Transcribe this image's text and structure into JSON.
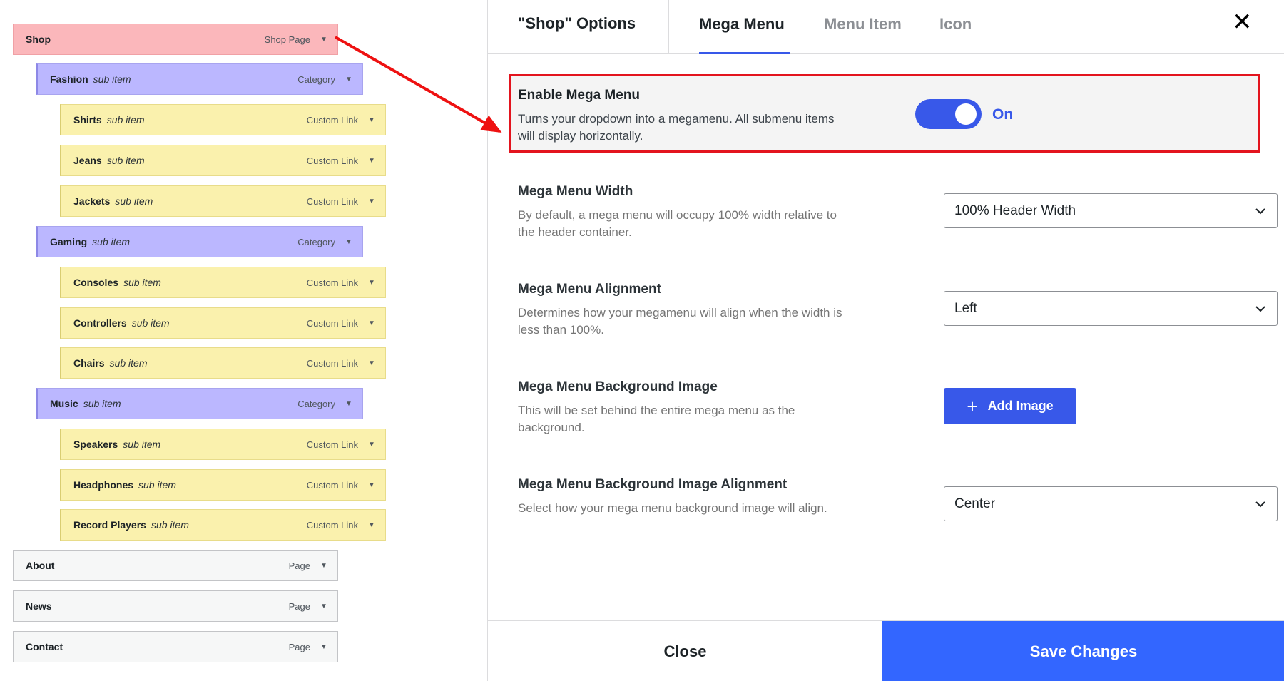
{
  "menu": {
    "items": [
      {
        "title": "Shop",
        "sub": "",
        "type": "Shop Page"
      },
      {
        "title": "Fashion",
        "sub": "sub item",
        "type": "Category"
      },
      {
        "title": "Shirts",
        "sub": "sub item",
        "type": "Custom Link"
      },
      {
        "title": "Jeans",
        "sub": "sub item",
        "type": "Custom Link"
      },
      {
        "title": "Jackets",
        "sub": "sub item",
        "type": "Custom Link"
      },
      {
        "title": "Gaming",
        "sub": "sub item",
        "type": "Category"
      },
      {
        "title": "Consoles",
        "sub": "sub item",
        "type": "Custom Link"
      },
      {
        "title": "Controllers",
        "sub": "sub item",
        "type": "Custom Link"
      },
      {
        "title": "Chairs",
        "sub": "sub item",
        "type": "Custom Link"
      },
      {
        "title": "Music",
        "sub": "sub item",
        "type": "Category"
      },
      {
        "title": "Speakers",
        "sub": "sub item",
        "type": "Custom Link"
      },
      {
        "title": "Headphones",
        "sub": "sub item",
        "type": "Custom Link"
      },
      {
        "title": "Record Players",
        "sub": "sub item",
        "type": "Custom Link"
      },
      {
        "title": "About",
        "sub": "",
        "type": "Page"
      },
      {
        "title": "News",
        "sub": "",
        "type": "Page"
      },
      {
        "title": "Contact",
        "sub": "",
        "type": "Page"
      }
    ],
    "arrow_glyph": "▼"
  },
  "panel": {
    "title": "\"Shop\" Options",
    "tabs": [
      "Mega Menu",
      "Menu Item",
      "Icon"
    ],
    "active_tab": "Mega Menu",
    "close_glyph": "✕",
    "enable": {
      "label": "Enable Mega Menu",
      "desc": "Turns your dropdown into a megamenu. All submenu items will display horizontally.",
      "state": "On"
    },
    "width": {
      "label": "Mega Menu Width",
      "desc": "By default, a mega menu will occupy 100% width relative to the header container.",
      "value": "100% Header Width"
    },
    "alignment": {
      "label": "Mega Menu Alignment",
      "desc": "Determines how your megamenu will align when the width is less than 100%.",
      "value": "Left"
    },
    "bg_image": {
      "label": "Mega Menu Background Image",
      "desc": "This will be set behind the entire mega menu as the background.",
      "button": "Add Image",
      "button_icon": "+"
    },
    "bg_align": {
      "label": "Mega Menu Background Image Alignment",
      "desc": "Select how your mega menu background image will align.",
      "value": "Center"
    },
    "footer": {
      "close": "Close",
      "save": "Save Changes"
    }
  },
  "colors": {
    "accent": "#3858e9",
    "save_bg": "#3366ff",
    "highlight_border": "#e3141e",
    "level0_active": "#fbb7bb",
    "level1": "#bbb7ff",
    "level2": "#faf1ad"
  }
}
